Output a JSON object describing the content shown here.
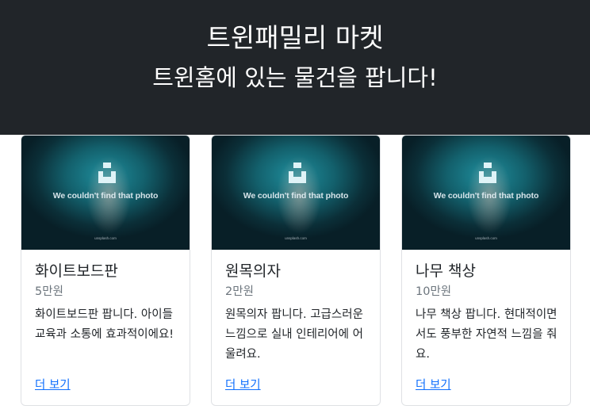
{
  "header": {
    "title": "트윈패밀리 마켓",
    "subtitle": "트윈홈에 있는 물건을 팝니다!"
  },
  "products": [
    {
      "image_text": "We couldn't find that photo",
      "image_url": "unsplash.com",
      "name": "화이트보드판",
      "price": "5만원",
      "description": "화이트보드판 팝니다. 아이들 교육과 소통에 효과적이에요!",
      "link_label": "더 보기"
    },
    {
      "image_text": "We couldn't find that photo",
      "image_url": "unsplash.com",
      "name": "원목의자",
      "price": "2만원",
      "description": "원목의자 팝니다. 고급스러운 느낌으로 실내 인테리어에 어울려요.",
      "link_label": "더 보기"
    },
    {
      "image_text": "We couldn't find that photo",
      "image_url": "unsplash.com",
      "name": "나무 책상",
      "price": "10만원",
      "description": "나무 책상 팝니다. 현대적이면서도 풍부한 자연적 느낌을 줘요.",
      "link_label": "더 보기"
    }
  ]
}
